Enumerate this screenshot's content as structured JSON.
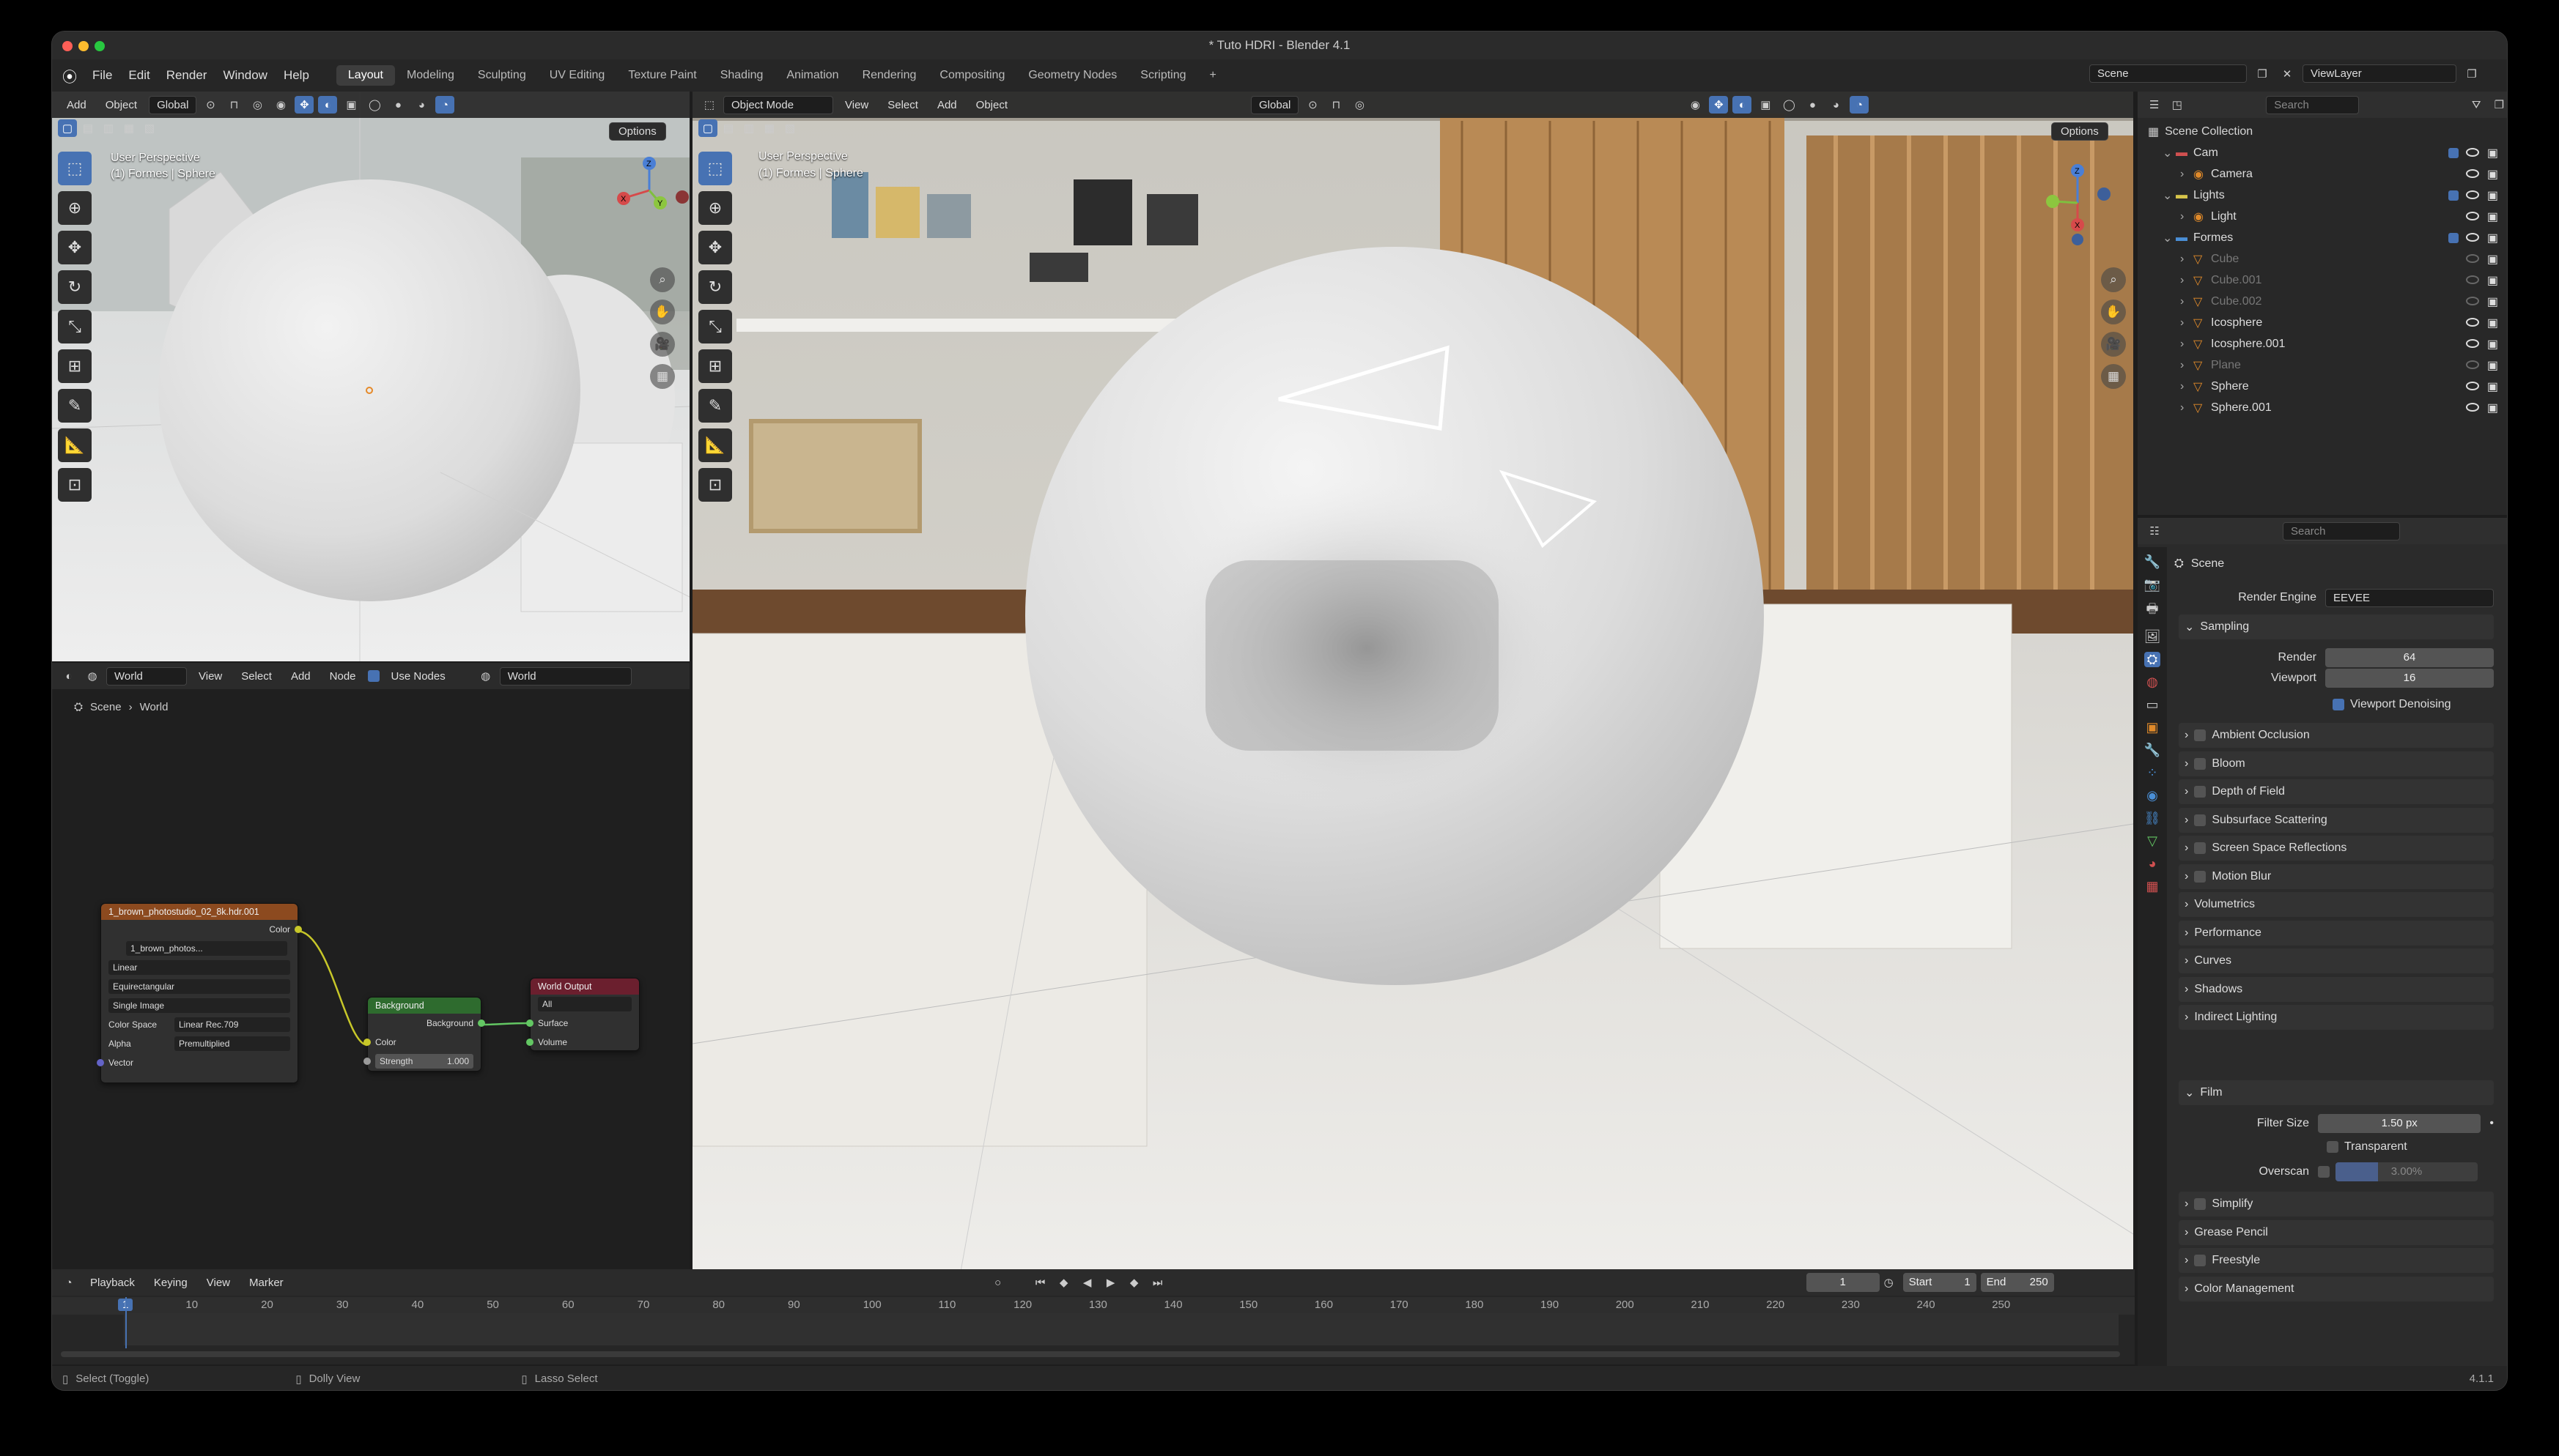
{
  "window": {
    "title": "* Tuto HDRI - Blender 4.1"
  },
  "menu": [
    "File",
    "Edit",
    "Render",
    "Window",
    "Help"
  ],
  "workspaces": [
    "Layout",
    "Modeling",
    "Sculpting",
    "UV Editing",
    "Texture Paint",
    "Shading",
    "Animation",
    "Rendering",
    "Compositing",
    "Geometry Nodes",
    "Scripting"
  ],
  "workspace_add": "+",
  "scene_selector": "Scene",
  "view_layer": "ViewLayer",
  "left_view": {
    "menus": [
      "Add",
      "Object"
    ],
    "orientation": "Global",
    "options": "Options",
    "overlay_line1": "User Perspective",
    "overlay_line2": "(1) Formes | Sphere"
  },
  "main_view": {
    "mode": "Object Mode",
    "menus": [
      "View",
      "Select",
      "Add",
      "Object"
    ],
    "orientation": "Global",
    "options": "Options",
    "overlay_line1": "User Perspective",
    "overlay_line2": "(1) Formes | Sphere"
  },
  "node_editor": {
    "type": "World",
    "menus": [
      "View",
      "Select",
      "Add",
      "Node"
    ],
    "use_nodes": "Use Nodes",
    "world": "World",
    "breadcrumb": [
      "Scene",
      "World"
    ],
    "env_node": {
      "title": "1_brown_photostudio_02_8k.hdr.001",
      "out": "Color",
      "image": "1_brown_photos...",
      "interp": "Linear",
      "proj": "Equirectangular",
      "source": "Single Image",
      "cs_label": "Color Space",
      "cs_value": "Linear Rec.709",
      "alpha_label": "Alpha",
      "alpha_value": "Premultiplied",
      "vector": "Vector"
    },
    "bg_node": {
      "title": "Background",
      "out": "Background",
      "color": "Color",
      "strength_label": "Strength",
      "strength_value": "1.000"
    },
    "out_node": {
      "title": "World Output",
      "target": "All",
      "surface": "Surface",
      "volume": "Volume"
    }
  },
  "outliner": {
    "search": "Search",
    "root": "Scene Collection",
    "rows": [
      {
        "label": "Cam",
        "kind": "collection"
      },
      {
        "label": "Camera",
        "kind": "object",
        "muted": false
      },
      {
        "label": "Lights",
        "kind": "collection"
      },
      {
        "label": "Light",
        "kind": "object",
        "muted": false
      },
      {
        "label": "Formes",
        "kind": "collection"
      },
      {
        "label": "Cube",
        "kind": "mesh",
        "muted": true
      },
      {
        "label": "Cube.001",
        "kind": "mesh",
        "muted": true
      },
      {
        "label": "Cube.002",
        "kind": "mesh",
        "muted": true
      },
      {
        "label": "Icosphere",
        "kind": "mesh",
        "muted": false
      },
      {
        "label": "Icosphere.001",
        "kind": "mesh",
        "muted": false
      },
      {
        "label": "Plane",
        "kind": "mesh",
        "muted": true
      },
      {
        "label": "Sphere",
        "kind": "mesh",
        "muted": false
      },
      {
        "label": "Sphere.001",
        "kind": "mesh",
        "muted": false
      }
    ]
  },
  "properties": {
    "search": "Search",
    "context": "Scene",
    "render_engine_label": "Render Engine",
    "render_engine": "EEVEE",
    "sampling": "Sampling",
    "render_label": "Render",
    "render_value": "64",
    "viewport_label": "Viewport",
    "viewport_value": "16",
    "denoise": "Viewport Denoising",
    "panels_a": [
      "Ambient Occlusion",
      "Bloom",
      "Depth of Field",
      "Subsurface Scattering",
      "Screen Space Reflections",
      "Motion Blur",
      "Volumetrics",
      "Performance",
      "Curves",
      "Shadows",
      "Indirect Lighting"
    ],
    "film": "Film",
    "filter_label": "Filter Size",
    "filter_value": "1.50 px",
    "transparent": "Transparent",
    "overscan_label": "Overscan",
    "overscan_value": "3.00%",
    "panels_b": [
      "Simplify",
      "Grease Pencil",
      "Freestyle",
      "Color Management"
    ]
  },
  "timeline": {
    "menus": [
      "Playback",
      "Keying",
      "View",
      "Marker"
    ],
    "current": "1",
    "start_label": "Start",
    "start": "1",
    "end_label": "End",
    "end": "250",
    "ticks": [
      "1",
      "10",
      "20",
      "30",
      "40",
      "50",
      "60",
      "70",
      "80",
      "90",
      "100",
      "110",
      "120",
      "130",
      "140",
      "150",
      "160",
      "170",
      "180",
      "190",
      "200",
      "210",
      "220",
      "230",
      "240",
      "250"
    ]
  },
  "status": {
    "select": "Select (Toggle)",
    "dolly": "Dolly View",
    "lasso": "Lasso Select",
    "version": "4.1.1"
  }
}
